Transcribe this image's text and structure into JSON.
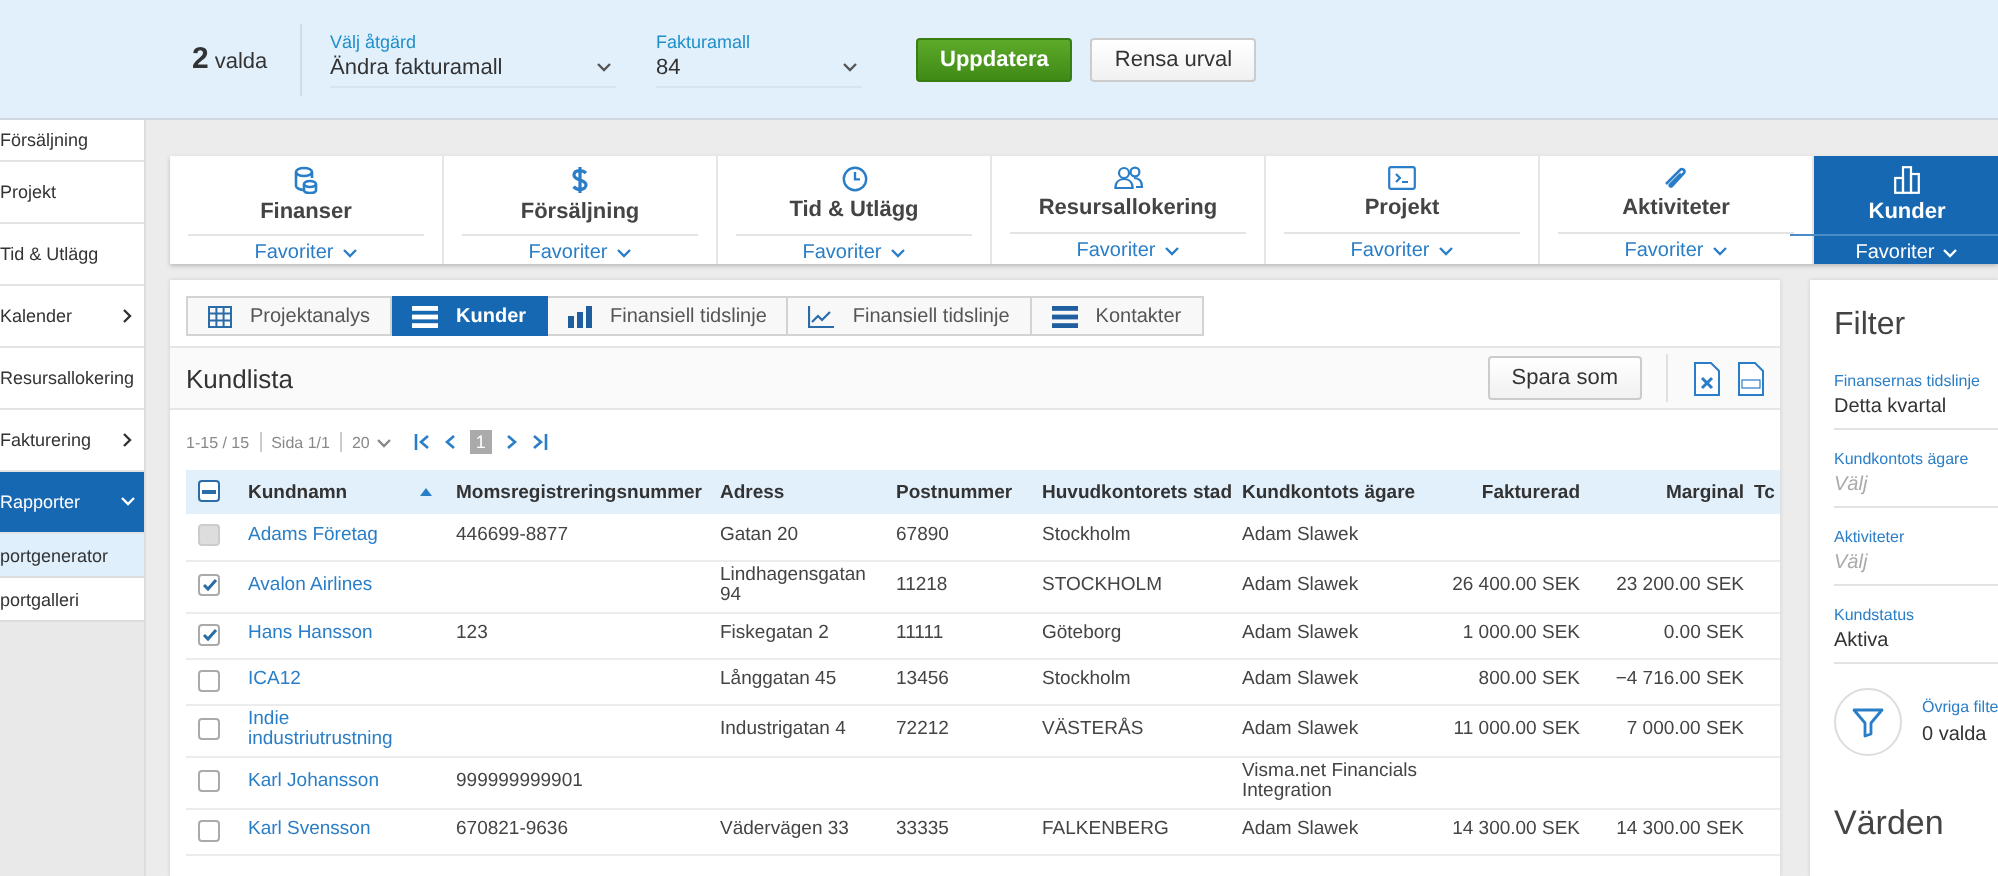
{
  "selection_bar": {
    "count": "2",
    "count_label": "valda",
    "fields": [
      {
        "label": "Välj åtgärd",
        "value": "Ändra fakturamall"
      },
      {
        "label": "Fakturamall",
        "value": "84"
      }
    ],
    "buttons": [
      {
        "label": "Uppdatera",
        "kind": "primary"
      },
      {
        "label": "Rensa urval",
        "kind": "secondary"
      }
    ]
  },
  "sidebar": {
    "items": [
      {
        "label": "Försäljning",
        "selected": false
      },
      {
        "label": "Projekt",
        "selected": false
      },
      {
        "label": "Tid & Utlägg",
        "selected": false
      },
      {
        "label": "Kalender",
        "selected": false,
        "expanded": false
      },
      {
        "label": "Resursallokering",
        "selected": false
      },
      {
        "label": "Fakturering",
        "selected": false,
        "expanded": false
      },
      {
        "label": "Rapporter",
        "selected": true,
        "expanded": true,
        "children": [
          {
            "label": "portgenerator",
            "selected": true
          },
          {
            "label": "portgalleri",
            "selected": false
          }
        ]
      }
    ]
  },
  "modules": [
    {
      "label": "Finanser",
      "favorites": "Favoriter",
      "selected": false
    },
    {
      "label": "Försäljning",
      "favorites": "Favoriter",
      "selected": false
    },
    {
      "label": "Tid & Utlägg",
      "favorites": "Favoriter",
      "selected": false
    },
    {
      "label": "Resursallokering",
      "favorites": "Favoriter",
      "selected": false
    },
    {
      "label": "Projekt",
      "favorites": "Favoriter",
      "selected": false
    },
    {
      "label": "Aktiviteter",
      "favorites": "Favoriter",
      "selected": false
    },
    {
      "label": "Kunder",
      "favorites": "Favoriter",
      "selected": true
    }
  ],
  "view_tabs": [
    {
      "label": "Projektanalys",
      "selected": false
    },
    {
      "label": "Kunder",
      "selected": true
    },
    {
      "label": "Finansiell tidslinje",
      "selected": false
    },
    {
      "label": "Finansiell tidslinje",
      "selected": false
    },
    {
      "label": "Kontakter",
      "selected": false
    }
  ],
  "list": {
    "title": "Kundlista",
    "save_button": "Spara som",
    "pager": {
      "range": "1-15 / 15",
      "page": "Sida 1/1",
      "page_size": "20",
      "current": "1"
    },
    "select_all_partial": true,
    "columns": [
      "Kundnamn",
      "Momsregistreringsnummer",
      "Adress",
      "Postnummer",
      "Huvudkontorets stad",
      "Kundkontots ägare",
      "Fakturerad",
      "Marginal",
      "Tc"
    ],
    "rows": [
      {
        "checked": false,
        "disabled": true,
        "cells": [
          "Adams Företag",
          "446699-8877",
          "Gatan 20",
          "67890",
          "Stockholm",
          "Adam Slawek",
          "",
          ""
        ]
      },
      {
        "checked": true,
        "disabled": false,
        "cells": [
          "Avalon Airlines",
          "",
          "Lindhagensgatan 94",
          "11218",
          "STOCKHOLM",
          "Adam Slawek",
          "26 400.00 SEK",
          "23 200.00 SEK"
        ]
      },
      {
        "checked": true,
        "disabled": false,
        "cells": [
          "Hans Hansson",
          "123",
          "Fiskegatan 2",
          "11111",
          "Göteborg",
          "Adam Slawek",
          "1 000.00 SEK",
          "0.00 SEK"
        ]
      },
      {
        "checked": false,
        "disabled": false,
        "cells": [
          "ICA12",
          "",
          "Långgatan 45",
          "13456",
          "Stockholm",
          "Adam Slawek",
          "800.00 SEK",
          "−4 716.00 SEK"
        ]
      },
      {
        "checked": false,
        "disabled": false,
        "cells": [
          "Indie industriutrustning",
          "",
          "Industrigatan 4",
          "72212",
          "VÄSTERÅS",
          "Adam Slawek",
          "11 000.00 SEK",
          "7 000.00 SEK"
        ]
      },
      {
        "checked": false,
        "disabled": false,
        "cells": [
          "Karl Johansson",
          "999999999901",
          "",
          "",
          "",
          "Visma.net Financials Integration",
          "",
          ""
        ]
      },
      {
        "checked": false,
        "disabled": false,
        "cells": [
          "Karl Svensson",
          "670821-9636",
          "Vädervägen 33",
          "33335",
          "FALKENBERG",
          "Adam Slawek",
          "14 300.00 SEK",
          "14 300.00 SEK"
        ]
      }
    ]
  },
  "filter": {
    "title": "Filter",
    "fields": [
      {
        "label": "Finansernas tidslinje",
        "value": "Detta kvartal"
      },
      {
        "label": "Kundkontots ägare",
        "placeholder": "Välj"
      },
      {
        "label": "Aktiviteter",
        "placeholder": "Välj"
      },
      {
        "label": "Kundstatus",
        "value": "Aktiva"
      }
    ],
    "other_filters": {
      "label": "Övriga filte",
      "value": "0 valda"
    },
    "values_title": "Värden"
  }
}
